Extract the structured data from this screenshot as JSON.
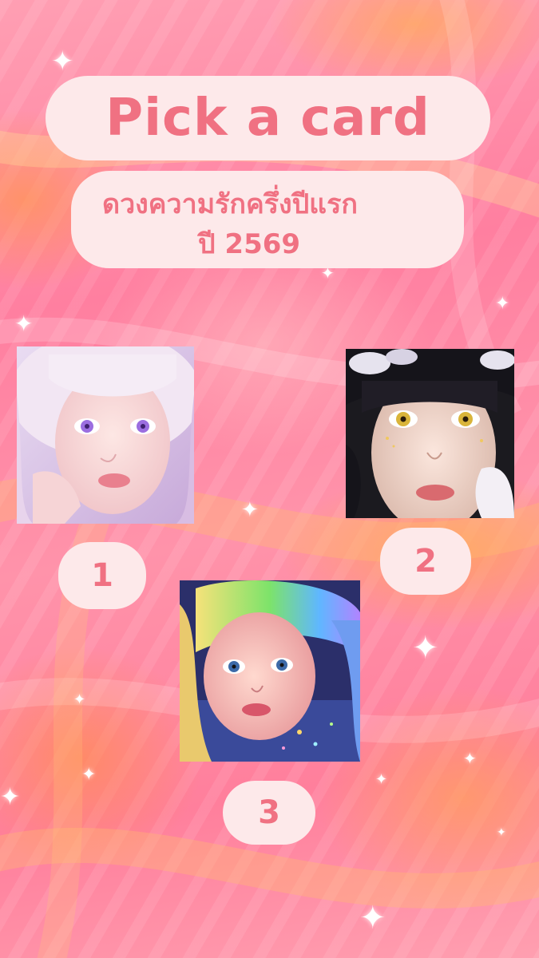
{
  "title": "Pick a card",
  "subtitle": {
    "line1": "ดวงความรักครึ่งปีแรก",
    "line2": "ปี 2569"
  },
  "cards": [
    {
      "number": "1",
      "image_icon": "lilac-haired-girl-portrait"
    },
    {
      "number": "2",
      "image_icon": "dark-haired-girl-portrait"
    },
    {
      "number": "3",
      "image_icon": "rainbow-haired-girl-portrait"
    }
  ],
  "colors": {
    "pill_background": "#fde9ea",
    "accent_text": "#f07182",
    "background_pink": "#ff8fa8",
    "background_orange": "#ffa85a"
  }
}
